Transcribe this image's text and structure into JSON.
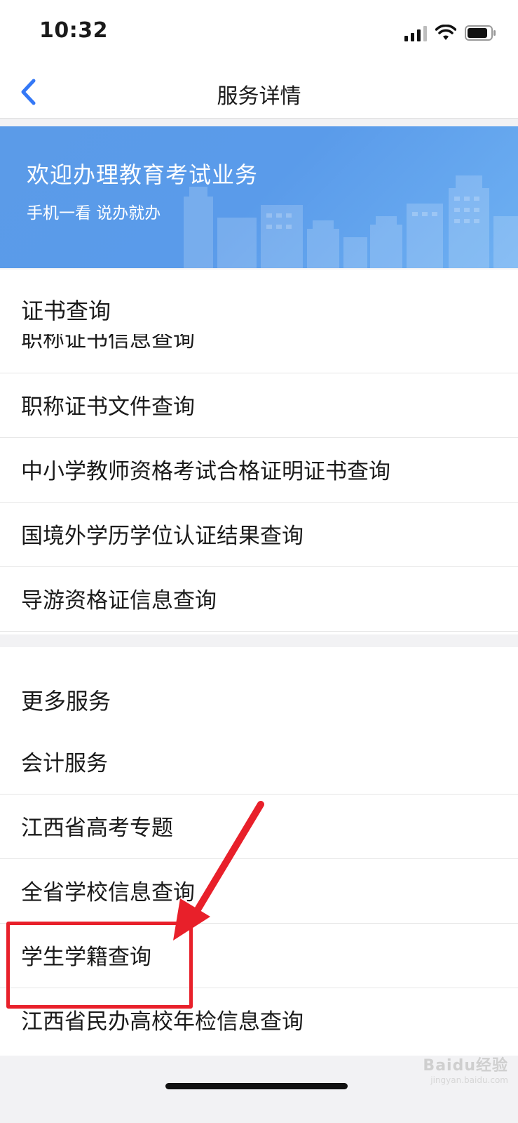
{
  "status_bar": {
    "time": "10:32"
  },
  "nav": {
    "title": "服务详情"
  },
  "banner": {
    "title": "欢迎办理教育考试业务",
    "subtitle": "手机一看 说办就办"
  },
  "certificate_section": {
    "heading": "证书查询",
    "items": [
      "职称证书信息查询",
      "职称证书文件查询",
      "中小学教师资格考试合格证明证书查询",
      "国境外学历学位认证结果查询",
      "导游资格证信息查询"
    ]
  },
  "more_section": {
    "heading": "更多服务",
    "items": [
      "会计服务",
      "江西省高考专题",
      "全省学校信息查询",
      "学生学籍查询",
      "江西省民办高校年检信息查询"
    ]
  },
  "watermark": {
    "brand": "Baidu经验",
    "domain": "jingyan.baidu.com"
  },
  "colors": {
    "accent": "#3478f6",
    "banner": "#5b9be8",
    "highlight": "#e8202a"
  }
}
